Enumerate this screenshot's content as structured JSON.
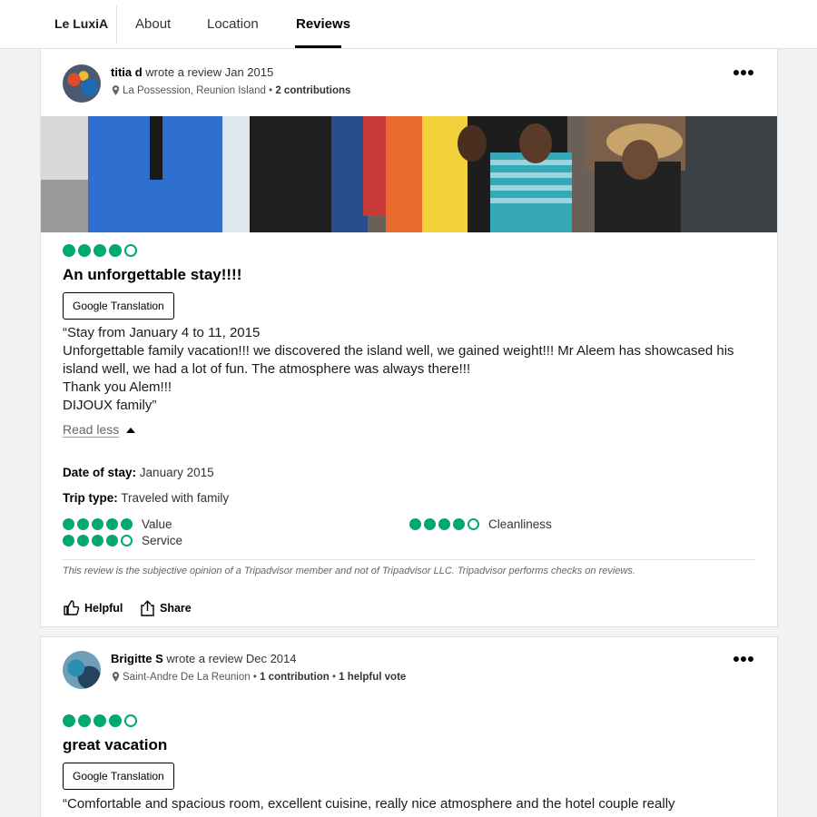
{
  "header": {
    "brand": "Le LuxiA",
    "tabs": [
      {
        "label": "About"
      },
      {
        "label": "Location"
      },
      {
        "label": "Reviews",
        "active": true
      }
    ]
  },
  "colors": {
    "accent_green": "#00aa6c",
    "text": "#1a1a1a",
    "muted": "#666666"
  },
  "reviews": [
    {
      "user": "titia d",
      "wrote": "wrote a review Jan 2015",
      "location": "La Possession, Reunion Island",
      "contributions": "2 contributions",
      "rating": 4,
      "title": "An unforgettable stay!!!!",
      "translate_label": "Google Translation",
      "body": "“Stay from January 4 to 11, 2015\nUnforgettable family vacation!!! we discovered the island well, we gained weight!!! Mr Aleem has showcased his island well, we had a lot of fun. The atmosphere was always there!!!\nThank you Alem!!!\nDIJOUX family”",
      "read_less": "Read less",
      "date_label": "Date of stay:",
      "date_value": "January 2015",
      "trip_label": "Trip type:",
      "trip_value": "Traveled with family",
      "subratings": [
        {
          "label": "Value",
          "rating": 5
        },
        {
          "label": "Cleanliness",
          "rating": 4
        },
        {
          "label": "Service",
          "rating": 4
        }
      ],
      "disclaimer": "This review is the subjective opinion of a Tripadvisor member and not of Tripadvisor LLC. Tripadvisor performs checks on reviews.",
      "helpful_label": "Helpful",
      "share_label": "Share"
    },
    {
      "user": "Brigitte S",
      "wrote": "wrote a review Dec 2014",
      "location": "Saint-Andre De La Reunion",
      "contributions": "1 contribution",
      "helpful_votes": "1 helpful vote",
      "rating": 4,
      "title": "great vacation",
      "translate_label": "Google Translation",
      "body": "“Comfortable and spacious room, excellent cuisine, really nice atmosphere and the hotel couple really"
    }
  ]
}
